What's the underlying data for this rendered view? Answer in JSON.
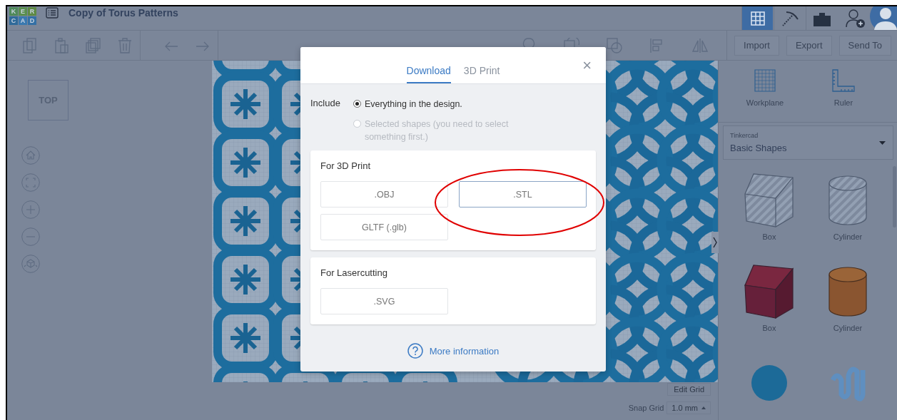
{
  "header": {
    "logo": [
      "K",
      "E",
      "R",
      "C",
      "A",
      "D"
    ],
    "title": "Copy of Torus Patterns",
    "view_modes": [
      {
        "kind": "grid",
        "selected": true
      },
      {
        "kind": "pickaxe",
        "selected": false
      },
      {
        "kind": "briefcase",
        "selected": false
      }
    ]
  },
  "toolbar": {
    "buttons": [
      "Import",
      "Export",
      "Send To"
    ]
  },
  "workspace": {
    "view_cube": "TOP",
    "edit_grid": "Edit Grid",
    "snap_grid": {
      "label": "Snap Grid",
      "value": "1.0 mm"
    }
  },
  "panel": {
    "tools": [
      {
        "kind": "workplane",
        "label": "Workplane"
      },
      {
        "kind": "ruler",
        "label": "Ruler"
      }
    ],
    "library": {
      "source": "Tinkercad",
      "category": "Basic Shapes"
    },
    "shapes": [
      {
        "kind": "box-hole",
        "label": "Box"
      },
      {
        "kind": "cylinder-hole",
        "label": "Cylinder"
      },
      {
        "kind": "box",
        "label": "Box"
      },
      {
        "kind": "cylinder",
        "label": "Cylinder"
      },
      {
        "kind": "sphere"
      },
      {
        "kind": "scribble"
      }
    ]
  },
  "dialog": {
    "tabs": [
      {
        "label": "Download",
        "selected": true
      },
      {
        "label": "3D Print",
        "selected": false
      }
    ],
    "close": "×",
    "include": {
      "label": "Include",
      "options": [
        {
          "label": "Everything in the design.",
          "selected": true,
          "disabled": false
        },
        {
          "label": "Selected shapes (you need to select something first.)",
          "selected": false,
          "disabled": true
        }
      ]
    },
    "sections": [
      {
        "title": "For 3D Print",
        "formats": [
          {
            "label": ".OBJ",
            "highlighted": false
          },
          {
            "label": ".STL",
            "highlighted": true
          },
          {
            "label": "GLTF (.glb)",
            "highlighted": false
          }
        ]
      },
      {
        "title": "For Lasercutting",
        "formats": [
          {
            "label": ".SVG",
            "highlighted": false
          }
        ]
      }
    ],
    "help": "More information"
  }
}
